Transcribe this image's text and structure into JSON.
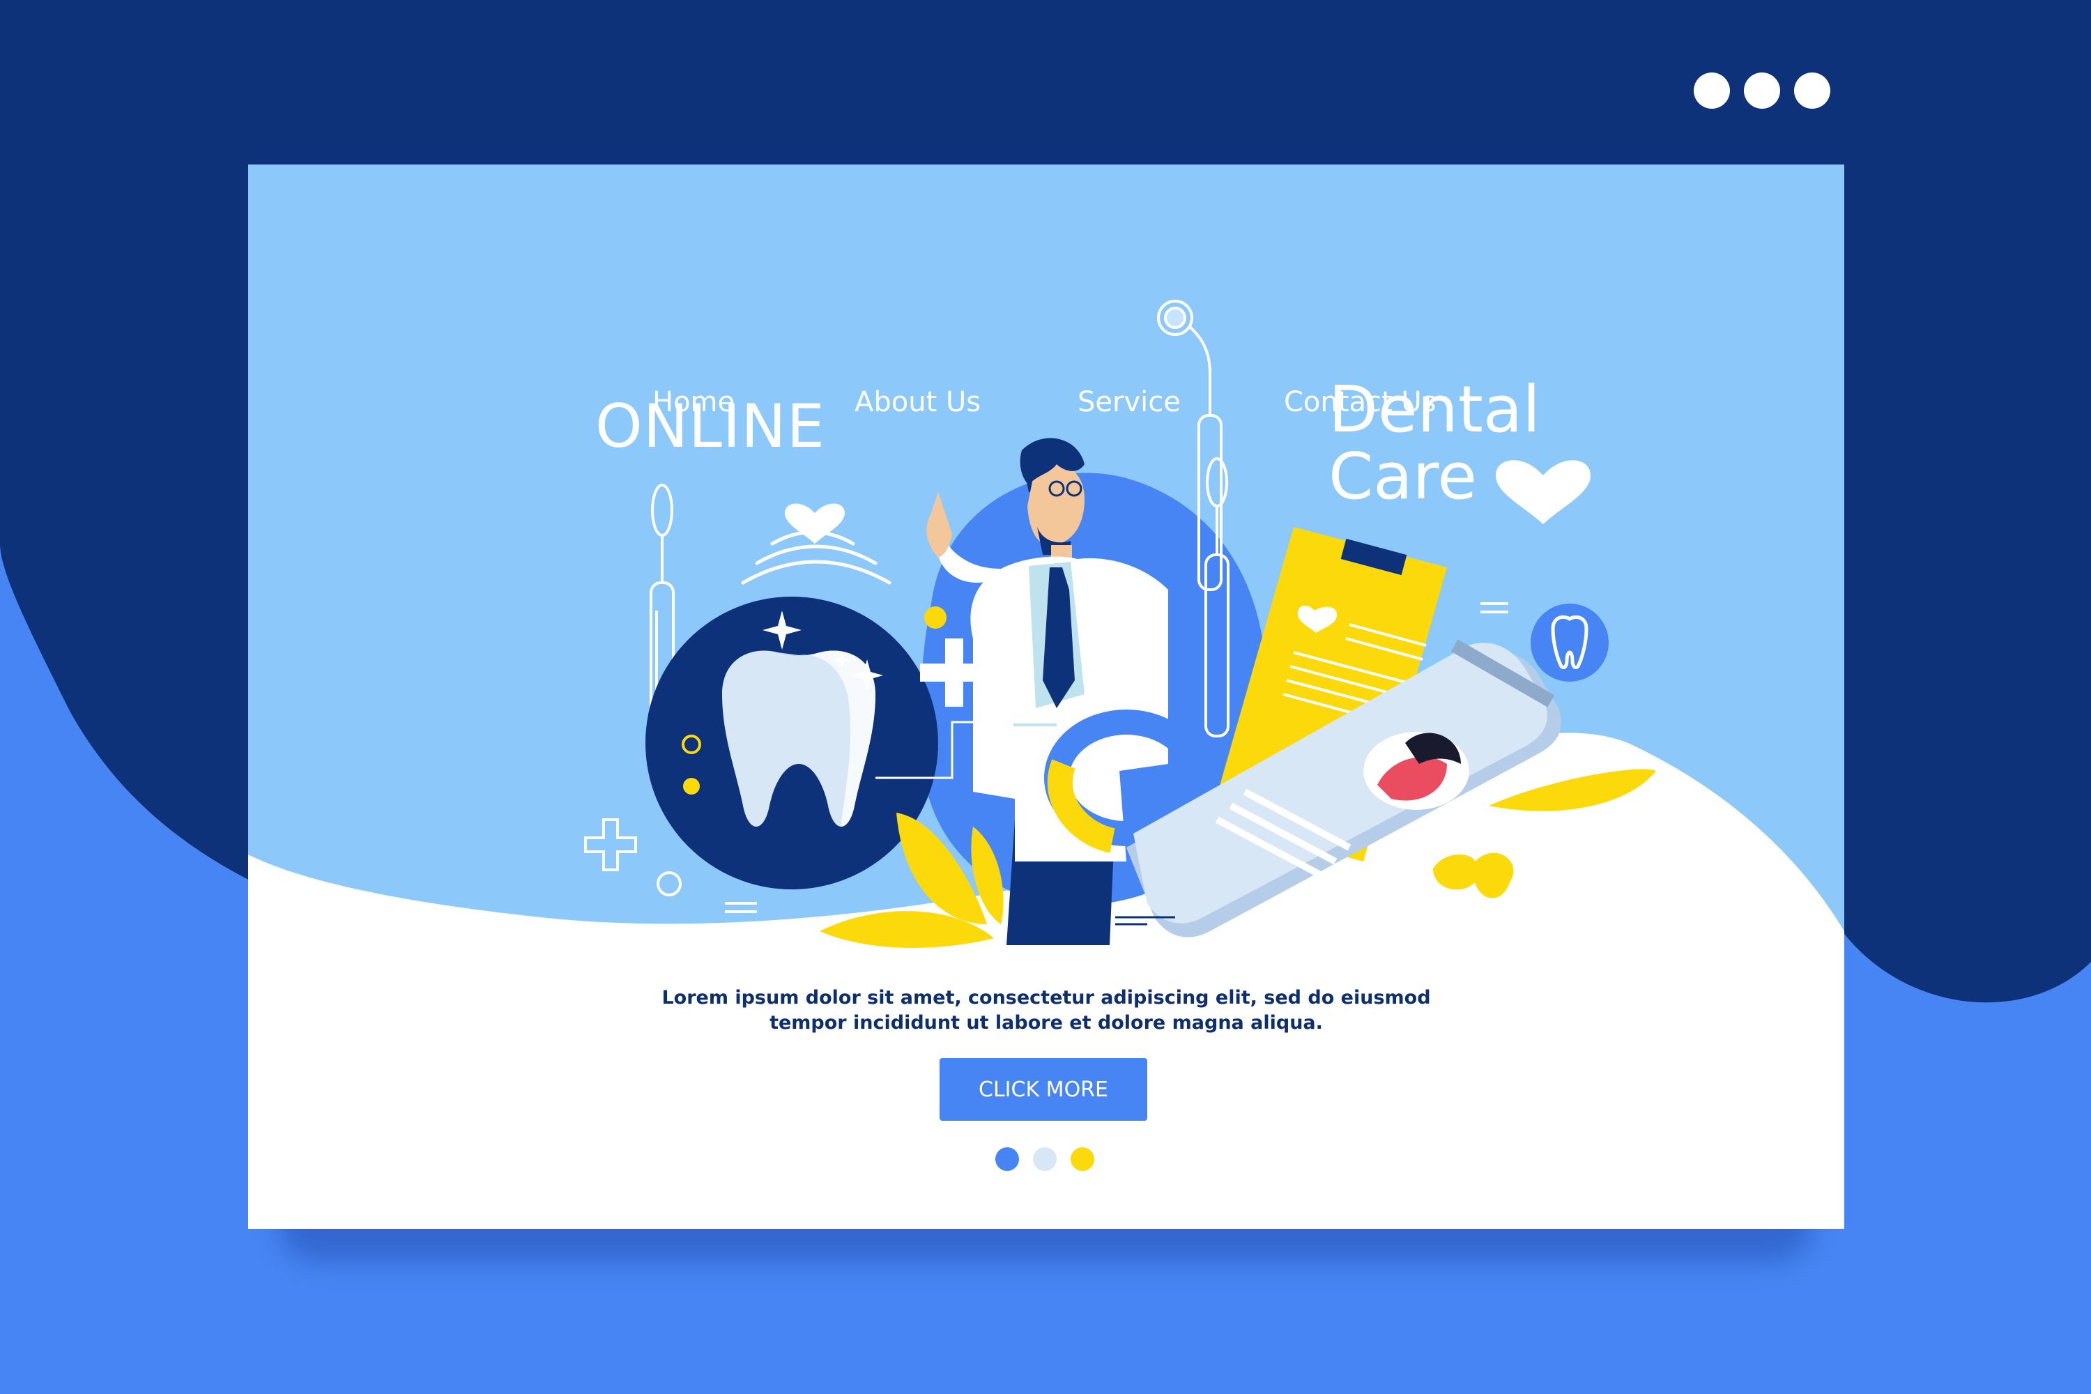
{
  "window": {
    "controls": [
      "dot-1",
      "dot-2",
      "dot-3"
    ]
  },
  "nav": {
    "home": "Home",
    "about": "About Us",
    "service": "Service",
    "contact": "Contact Us"
  },
  "hero": {
    "online": "ONLINE",
    "dental": "Dental",
    "care": "Care"
  },
  "content": {
    "line1": "Lorem ipsum dolor sit amet, consectetur adipiscing elit, sed do eiusmod",
    "line2": "tempor incididunt ut labore et dolore magna aliqua.",
    "button": "CLICK MORE"
  },
  "pager": {
    "count": 3,
    "active_index": 0
  },
  "colors": {
    "navy": "#0e3279",
    "blue": "#4685f3",
    "light_blue": "#8dc8fa",
    "yellow": "#fbd90b",
    "white": "#ffffff",
    "pale": "#d7e7f5"
  },
  "icons": [
    "tooth-icon",
    "heart-icon",
    "plus-icon",
    "sparkle-icon",
    "doctor-illustration",
    "clipboard-icon",
    "phone-icon",
    "mirror-tool-icon"
  ]
}
